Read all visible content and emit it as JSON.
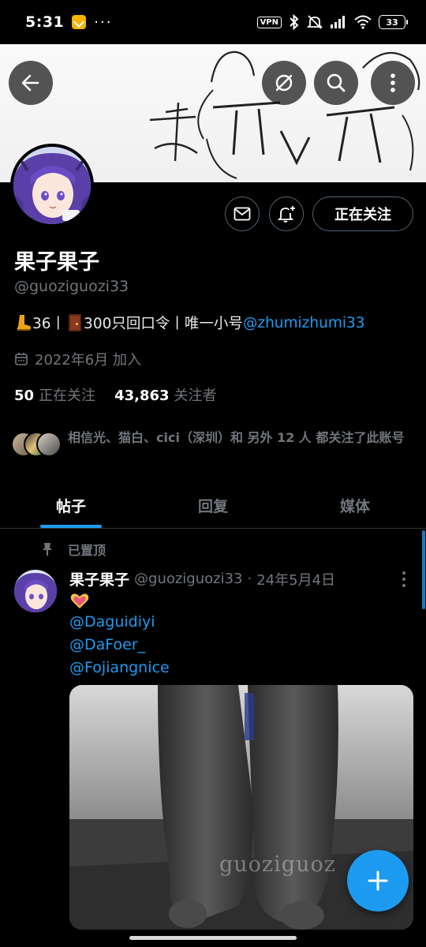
{
  "status_bar": {
    "time": "5:31",
    "dots": "···",
    "vpn": "VPN",
    "battery": "33",
    "icons": [
      "app-notification-icon",
      "vpn-icon",
      "bluetooth-icon",
      "mute-icon",
      "signal-icon",
      "wifi-icon",
      "battery-icon"
    ]
  },
  "banner": {
    "handwriting": "哭 π_π",
    "buttons": [
      "back-arrow-icon",
      "grok-icon",
      "search-icon",
      "more-vertical-icon"
    ]
  },
  "profile": {
    "display_name": "果子果子",
    "handle": "@guoziguozi33",
    "bio_prefix": "36丨",
    "bio_middle": "300只回口令丨唯一小号",
    "bio_link": "@zhumizhumi33",
    "joined": "2022年6月 加入",
    "following_count": "50",
    "following_label": "正在关注",
    "followers_count": "43,863",
    "followers_label": "关注者",
    "followers_you_know": "相信光、猫白、cici（深圳）和 另外 12 人 都关注了此账号",
    "follow_button": "正在关注"
  },
  "tabs": [
    {
      "label": "帖子",
      "active": true
    },
    {
      "label": "回复",
      "active": false
    },
    {
      "label": "媒体",
      "active": false
    }
  ],
  "post": {
    "pinned_label": "已置顶",
    "author_name": "果子果子",
    "author_handle": "@guoziguozi33",
    "separator": "·",
    "date": "24年5月4日",
    "mentions": [
      "@Daguidiyi",
      "@DaFoer_",
      "@Fojiangnice"
    ],
    "media_watermark": "guoziguoz"
  },
  "colors": {
    "accent": "#1d9bf0",
    "background": "#000000",
    "secondary_text": "#71767b",
    "divider": "#2f3336"
  }
}
